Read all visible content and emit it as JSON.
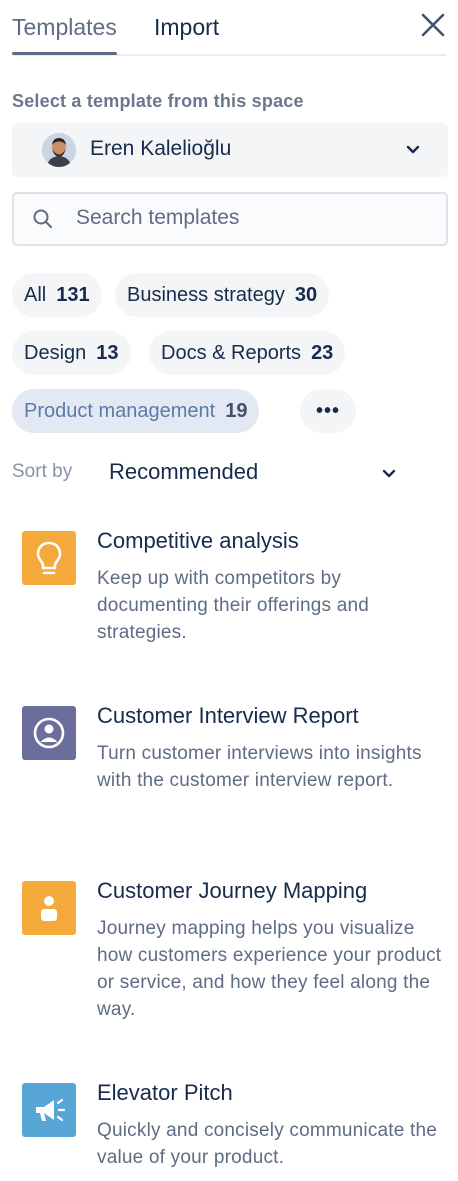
{
  "tabs": [
    {
      "label": "Templates",
      "active": true
    },
    {
      "label": "Import",
      "active": false
    }
  ],
  "close_icon": "close-icon",
  "space": {
    "label": "Select a template from this space",
    "selected": "Eren Kalelioğlu"
  },
  "search": {
    "placeholder": "Search templates",
    "value": ""
  },
  "categories": [
    {
      "name": "All",
      "count": "131"
    },
    {
      "name": "Business strategy",
      "count": "30"
    },
    {
      "name": "Design",
      "count": "13"
    },
    {
      "name": "Docs & Reports",
      "count": "23"
    },
    {
      "name": "Product management",
      "count": "19",
      "selected": true
    }
  ],
  "more_label": "•••",
  "sort": {
    "label": "Sort by",
    "value": "Recommended"
  },
  "templates": [
    {
      "title": "Competitive analysis",
      "description": "Keep up with competitors by documenting their offerings and strategies.",
      "icon": "lightbulb-icon",
      "color": "#f4a93b"
    },
    {
      "title": "Customer Interview Report",
      "description": "Turn customer interviews into insights with the customer interview report.",
      "icon": "user-circle-icon",
      "color": "#6b6e9a"
    },
    {
      "title": "Customer Journey Mapping",
      "description": "Journey mapping helps you visualize how customers experience your product or service, and how they feel along the way.",
      "icon": "person-icon",
      "color": "#f4a93b"
    },
    {
      "title": "Elevator Pitch",
      "description": "Quickly and concisely communicate the value of your product.",
      "icon": "megaphone-icon",
      "color": "#57a6d6"
    }
  ],
  "colors": {
    "accent": "#5e6c84",
    "chip_bg": "#f4f5f7",
    "chip_selected_bg": "#e2e9f2"
  }
}
